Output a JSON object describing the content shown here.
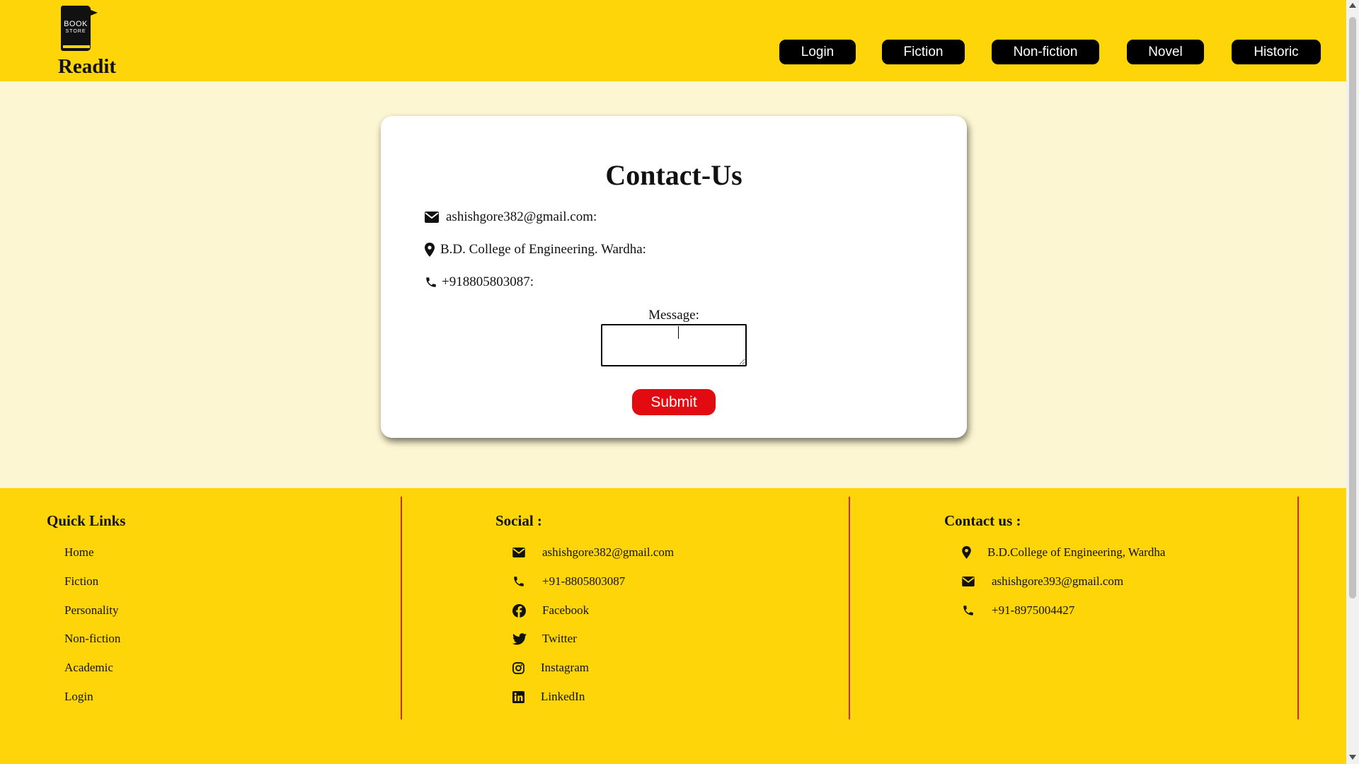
{
  "brand": {
    "logo_line1": "BOOK",
    "logo_line2": "STORE",
    "name": "Readit"
  },
  "nav": [
    {
      "label": "Login"
    },
    {
      "label": "Fiction"
    },
    {
      "label": "Non-fiction"
    },
    {
      "label": "Novel"
    },
    {
      "label": "Historic"
    }
  ],
  "contact_card": {
    "title": "Contact-Us",
    "email": "ashishgore382@gmail.com:",
    "address": "B.D. College of Engineering. Wardha:",
    "phone": "+918805803087:",
    "message_label": "Message:",
    "message_value": "",
    "submit_label": "Submit"
  },
  "footer": {
    "quick_links": {
      "title": "Quick Links",
      "items": [
        "Home",
        "Fiction",
        "Personality",
        "Non-fiction",
        "Academic",
        "Login"
      ]
    },
    "social": {
      "title": "Social :",
      "items": [
        {
          "icon": "envelope-icon",
          "label": "ashishgore382@gmail.com"
        },
        {
          "icon": "phone-icon",
          "label": "+91-8805803087"
        },
        {
          "icon": "facebook-icon",
          "label": "Facebook"
        },
        {
          "icon": "twitter-icon",
          "label": "Twitter"
        },
        {
          "icon": "instagram-icon",
          "label": "Instagram"
        },
        {
          "icon": "linkedin-icon",
          "label": "LinkedIn"
        }
      ]
    },
    "contact": {
      "title": "Contact us :",
      "items": [
        {
          "icon": "location-icon",
          "label": "B.D.College of Engineering, Wardha"
        },
        {
          "icon": "envelope-icon",
          "label": "ashishgore393@gmail.com"
        },
        {
          "icon": "phone-icon",
          "label": "+91-8975004427"
        }
      ]
    }
  },
  "colors": {
    "header_bg": "#fed508",
    "page_bg": "#fcf6d2",
    "nav_button_bg": "#000000",
    "submit_bg": "#e30b12",
    "divider": "#d7262c"
  }
}
